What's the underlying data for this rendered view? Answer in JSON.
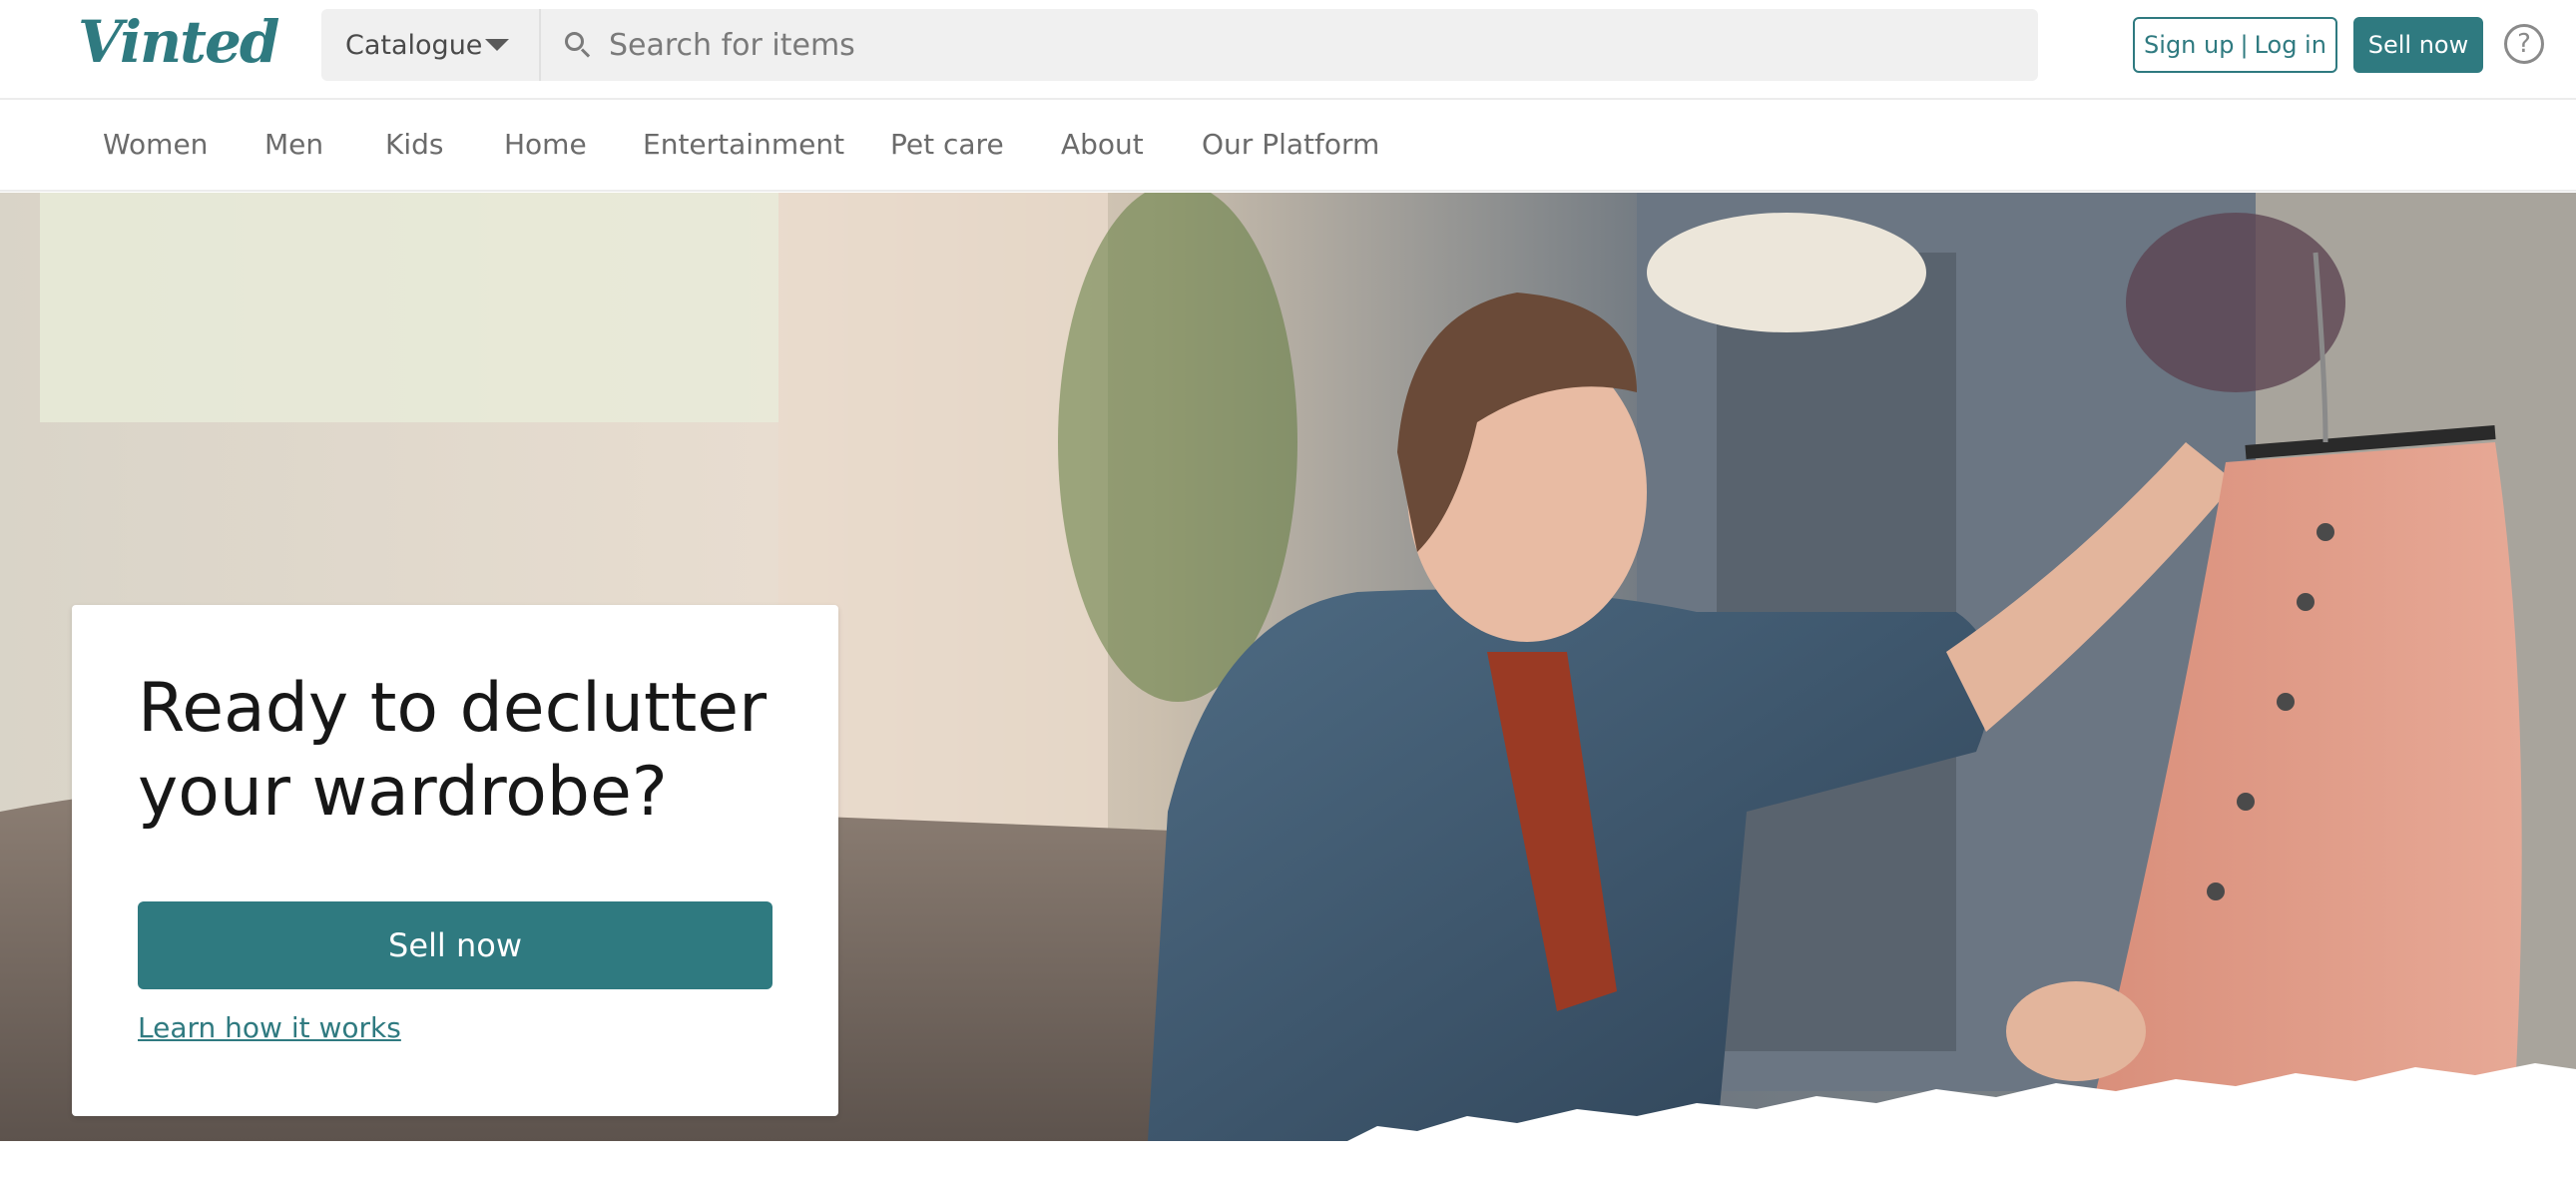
{
  "header": {
    "logo": "Vinted",
    "catalogue_label": "Catalogue",
    "search_placeholder": "Search for items",
    "signup_label": "Sign up",
    "separator": "|",
    "login_label": "Log in",
    "sell_now_label": "Sell now",
    "help_symbol": "?"
  },
  "nav": {
    "items": [
      "Women",
      "Men",
      "Kids",
      "Home",
      "Entertainment",
      "Pet care",
      "About",
      "Our Platform"
    ]
  },
  "hero": {
    "title": "Ready to declutter your wardrobe?",
    "sell_button": "Sell now",
    "learn_link": "Learn how it works"
  },
  "colors": {
    "brand": "#2f7a80",
    "nav_text": "#6b6b6b",
    "search_bg": "#f0f0f0"
  },
  "icons": {
    "search": "search-icon",
    "catalogue_caret": "chevron-down-icon",
    "help": "help-icon"
  }
}
